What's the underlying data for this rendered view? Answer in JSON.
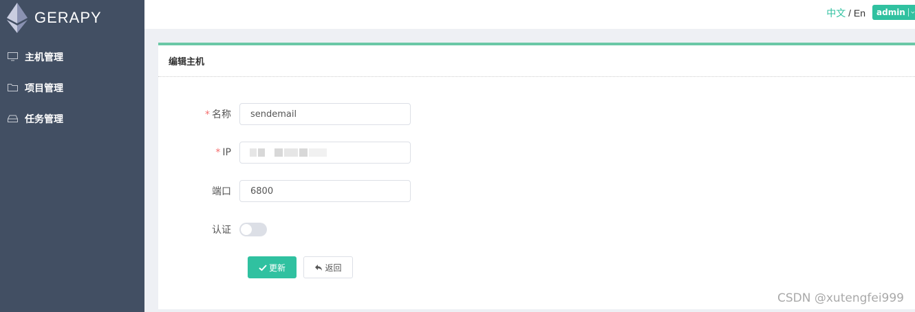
{
  "app": {
    "logo_text": "GERAPY"
  },
  "sidebar": {
    "items": [
      {
        "label": "主机管理",
        "icon": "monitor-icon"
      },
      {
        "label": "项目管理",
        "icon": "folder-icon"
      },
      {
        "label": "任务管理",
        "icon": "inbox-icon"
      }
    ]
  },
  "header": {
    "lang_zh": "中文",
    "lang_sep": "/",
    "lang_en": "En",
    "user": "admin"
  },
  "card": {
    "title": "编辑主机",
    "fields": {
      "name": {
        "label": "名称",
        "value": "sendemail",
        "required": "*"
      },
      "ip": {
        "label": "IP",
        "required": "*"
      },
      "port": {
        "label": "端口",
        "value": "6800"
      },
      "auth": {
        "label": "认证"
      }
    },
    "buttons": {
      "update": "更新",
      "back": "返回"
    }
  },
  "watermark": "CSDN @xutengfei999",
  "colors": {
    "accent": "#30c1a0",
    "sidebar_bg": "#424f63",
    "card_border": "#6ac8a6"
  }
}
